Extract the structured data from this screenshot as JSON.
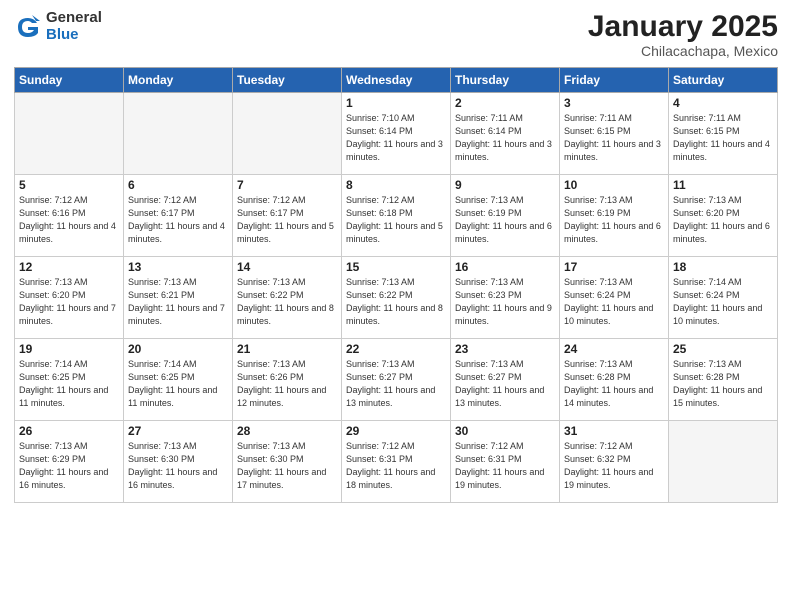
{
  "header": {
    "logo_general": "General",
    "logo_blue": "Blue",
    "month_title": "January 2025",
    "location": "Chilacachapa, Mexico"
  },
  "days_of_week": [
    "Sunday",
    "Monday",
    "Tuesday",
    "Wednesday",
    "Thursday",
    "Friday",
    "Saturday"
  ],
  "weeks": [
    [
      {
        "day": "",
        "info": ""
      },
      {
        "day": "",
        "info": ""
      },
      {
        "day": "",
        "info": ""
      },
      {
        "day": "1",
        "info": "Sunrise: 7:10 AM\nSunset: 6:14 PM\nDaylight: 11 hours\nand 3 minutes."
      },
      {
        "day": "2",
        "info": "Sunrise: 7:11 AM\nSunset: 6:14 PM\nDaylight: 11 hours\nand 3 minutes."
      },
      {
        "day": "3",
        "info": "Sunrise: 7:11 AM\nSunset: 6:15 PM\nDaylight: 11 hours\nand 3 minutes."
      },
      {
        "day": "4",
        "info": "Sunrise: 7:11 AM\nSunset: 6:15 PM\nDaylight: 11 hours\nand 4 minutes."
      }
    ],
    [
      {
        "day": "5",
        "info": "Sunrise: 7:12 AM\nSunset: 6:16 PM\nDaylight: 11 hours\nand 4 minutes."
      },
      {
        "day": "6",
        "info": "Sunrise: 7:12 AM\nSunset: 6:17 PM\nDaylight: 11 hours\nand 4 minutes."
      },
      {
        "day": "7",
        "info": "Sunrise: 7:12 AM\nSunset: 6:17 PM\nDaylight: 11 hours\nand 5 minutes."
      },
      {
        "day": "8",
        "info": "Sunrise: 7:12 AM\nSunset: 6:18 PM\nDaylight: 11 hours\nand 5 minutes."
      },
      {
        "day": "9",
        "info": "Sunrise: 7:13 AM\nSunset: 6:19 PM\nDaylight: 11 hours\nand 6 minutes."
      },
      {
        "day": "10",
        "info": "Sunrise: 7:13 AM\nSunset: 6:19 PM\nDaylight: 11 hours\nand 6 minutes."
      },
      {
        "day": "11",
        "info": "Sunrise: 7:13 AM\nSunset: 6:20 PM\nDaylight: 11 hours\nand 6 minutes."
      }
    ],
    [
      {
        "day": "12",
        "info": "Sunrise: 7:13 AM\nSunset: 6:20 PM\nDaylight: 11 hours\nand 7 minutes."
      },
      {
        "day": "13",
        "info": "Sunrise: 7:13 AM\nSunset: 6:21 PM\nDaylight: 11 hours\nand 7 minutes."
      },
      {
        "day": "14",
        "info": "Sunrise: 7:13 AM\nSunset: 6:22 PM\nDaylight: 11 hours\nand 8 minutes."
      },
      {
        "day": "15",
        "info": "Sunrise: 7:13 AM\nSunset: 6:22 PM\nDaylight: 11 hours\nand 8 minutes."
      },
      {
        "day": "16",
        "info": "Sunrise: 7:13 AM\nSunset: 6:23 PM\nDaylight: 11 hours\nand 9 minutes."
      },
      {
        "day": "17",
        "info": "Sunrise: 7:13 AM\nSunset: 6:24 PM\nDaylight: 11 hours\nand 10 minutes."
      },
      {
        "day": "18",
        "info": "Sunrise: 7:14 AM\nSunset: 6:24 PM\nDaylight: 11 hours\nand 10 minutes."
      }
    ],
    [
      {
        "day": "19",
        "info": "Sunrise: 7:14 AM\nSunset: 6:25 PM\nDaylight: 11 hours\nand 11 minutes."
      },
      {
        "day": "20",
        "info": "Sunrise: 7:14 AM\nSunset: 6:25 PM\nDaylight: 11 hours\nand 11 minutes."
      },
      {
        "day": "21",
        "info": "Sunrise: 7:13 AM\nSunset: 6:26 PM\nDaylight: 11 hours\nand 12 minutes."
      },
      {
        "day": "22",
        "info": "Sunrise: 7:13 AM\nSunset: 6:27 PM\nDaylight: 11 hours\nand 13 minutes."
      },
      {
        "day": "23",
        "info": "Sunrise: 7:13 AM\nSunset: 6:27 PM\nDaylight: 11 hours\nand 13 minutes."
      },
      {
        "day": "24",
        "info": "Sunrise: 7:13 AM\nSunset: 6:28 PM\nDaylight: 11 hours\nand 14 minutes."
      },
      {
        "day": "25",
        "info": "Sunrise: 7:13 AM\nSunset: 6:28 PM\nDaylight: 11 hours\nand 15 minutes."
      }
    ],
    [
      {
        "day": "26",
        "info": "Sunrise: 7:13 AM\nSunset: 6:29 PM\nDaylight: 11 hours\nand 16 minutes."
      },
      {
        "day": "27",
        "info": "Sunrise: 7:13 AM\nSunset: 6:30 PM\nDaylight: 11 hours\nand 16 minutes."
      },
      {
        "day": "28",
        "info": "Sunrise: 7:13 AM\nSunset: 6:30 PM\nDaylight: 11 hours\nand 17 minutes."
      },
      {
        "day": "29",
        "info": "Sunrise: 7:12 AM\nSunset: 6:31 PM\nDaylight: 11 hours\nand 18 minutes."
      },
      {
        "day": "30",
        "info": "Sunrise: 7:12 AM\nSunset: 6:31 PM\nDaylight: 11 hours\nand 19 minutes."
      },
      {
        "day": "31",
        "info": "Sunrise: 7:12 AM\nSunset: 6:32 PM\nDaylight: 11 hours\nand 19 minutes."
      },
      {
        "day": "",
        "info": ""
      }
    ]
  ]
}
